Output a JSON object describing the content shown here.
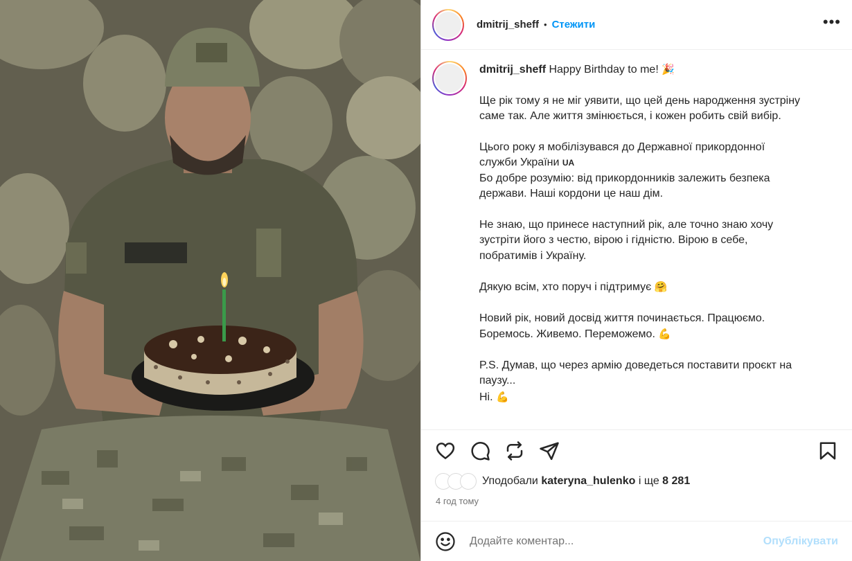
{
  "post": {
    "author": "dmitrij_sheff",
    "separator": "•",
    "follow_label": "Стежити",
    "more_icon": "more-horizontal-icon",
    "photo_alt": "photo"
  },
  "caption": {
    "author": "dmitrij_sheff",
    "line1": "Happy Birthday to me!",
    "emoji_party": "🎉",
    "para1": "Ще рік тому я не міг уявити, що цей день народження зустріну саме так. Але життя змінюється, і кожен робить свій вибір.",
    "para2a": "Цього року я мобілізувався до Державної прикордонної служби України",
    "flag_text": "UA",
    "para2b": "Бо добре розумію: від прикордонників залежить безпека держави. Наші кордони це наш дім.",
    "para3": "Не знаю, що принесе наступний рік, але точно знаю хочу зустріти його з честю, вірою і гідністю. Вірою в себе, побратимів і Україну.",
    "para4": "Дякую всім, хто поруч і підтримує",
    "emoji_hug": "🤗",
    "para5": "Новий рік, новий досвід життя починається. Працюємо. Боремось. Живемо. Переможемо.",
    "emoji_muscle": "💪",
    "para6": "P.S. Думав, що через армію доведеться поставити проєкт на паузу...",
    "para6b": "Ні.",
    "emoji_muscle2": "💪"
  },
  "actions": {
    "like_icon": "heart-icon",
    "comment_icon": "comment-icon",
    "repost_icon": "repost-icon",
    "share_icon": "send-icon",
    "save_icon": "bookmark-icon"
  },
  "likes": {
    "prefix": "Уподобали",
    "user": "kateryna_hulenko",
    "suffix": "і ще",
    "count": "8 281"
  },
  "timestamp": "4 год тому",
  "comment": {
    "placeholder": "Додайте коментар...",
    "post_label": "Опублікувати"
  },
  "colors": {
    "accent": "#0095f6",
    "post_disabled": "#b2dffc",
    "muted": "#737373"
  }
}
